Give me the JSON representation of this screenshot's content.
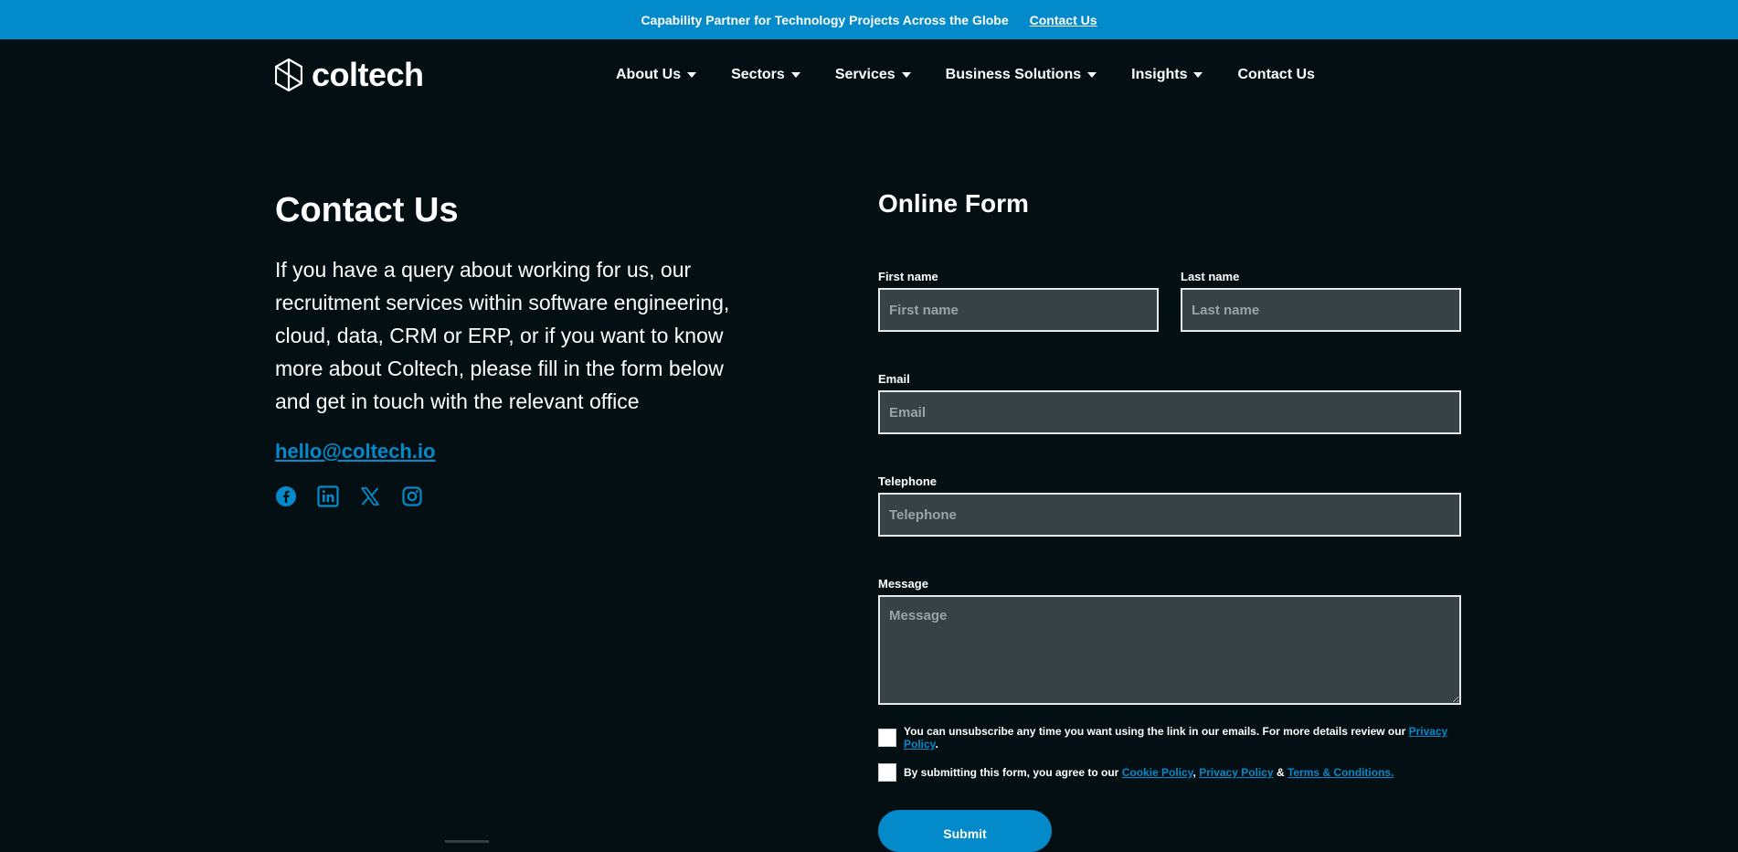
{
  "topbar": {
    "message": "Capability Partner for Technology Projects Across the Globe",
    "link": "Contact Us",
    "bg_color": "#038acb"
  },
  "logo": {
    "text": "coltech"
  },
  "nav": {
    "items": [
      {
        "label": "About Us",
        "dropdown": true
      },
      {
        "label": "Sectors",
        "dropdown": true
      },
      {
        "label": "Services",
        "dropdown": true
      },
      {
        "label": "Business Solutions",
        "dropdown": true
      },
      {
        "label": "Insights",
        "dropdown": true
      },
      {
        "label": "Contact Us",
        "dropdown": false
      }
    ]
  },
  "contact": {
    "title": "Contact Us",
    "intro": "If you have a query about working for us, our recruitment services within software engineering, cloud, data, CRM or ERP, or if you want to know more about Coltech, please fill in the form below and get in touch with the relevant office",
    "email": "hello@coltech.io",
    "socials": [
      "facebook-icon",
      "linkedin-icon",
      "x-icon",
      "instagram-icon"
    ]
  },
  "form": {
    "title": "Online Form",
    "first_name": {
      "label": "First name",
      "placeholder": "First name",
      "value": ""
    },
    "last_name": {
      "label": "Last name",
      "placeholder": "Last name",
      "value": ""
    },
    "email": {
      "label": "Email",
      "placeholder": "Email",
      "value": ""
    },
    "telephone": {
      "label": "Telephone",
      "placeholder": "Telephone",
      "value": ""
    },
    "message": {
      "label": "Message",
      "placeholder": "Message",
      "value": ""
    },
    "consent1": {
      "text": "You can unsubscribe any time you want using the link in our emails. For more details review our",
      "link": "Privacy Policy",
      "suffix": ".",
      "checked": false
    },
    "consent2": {
      "text": "By submitting this form, you agree to our",
      "link1": "Cookie Policy",
      "sep1": ",",
      "link2": "Privacy Policy",
      "sep2": "&",
      "link3": "Terms & Conditions.",
      "checked": false
    },
    "submit_label": "Submit"
  },
  "colors": {
    "background": "#030f13",
    "accent": "#038acb",
    "input_bg": "#364246"
  }
}
